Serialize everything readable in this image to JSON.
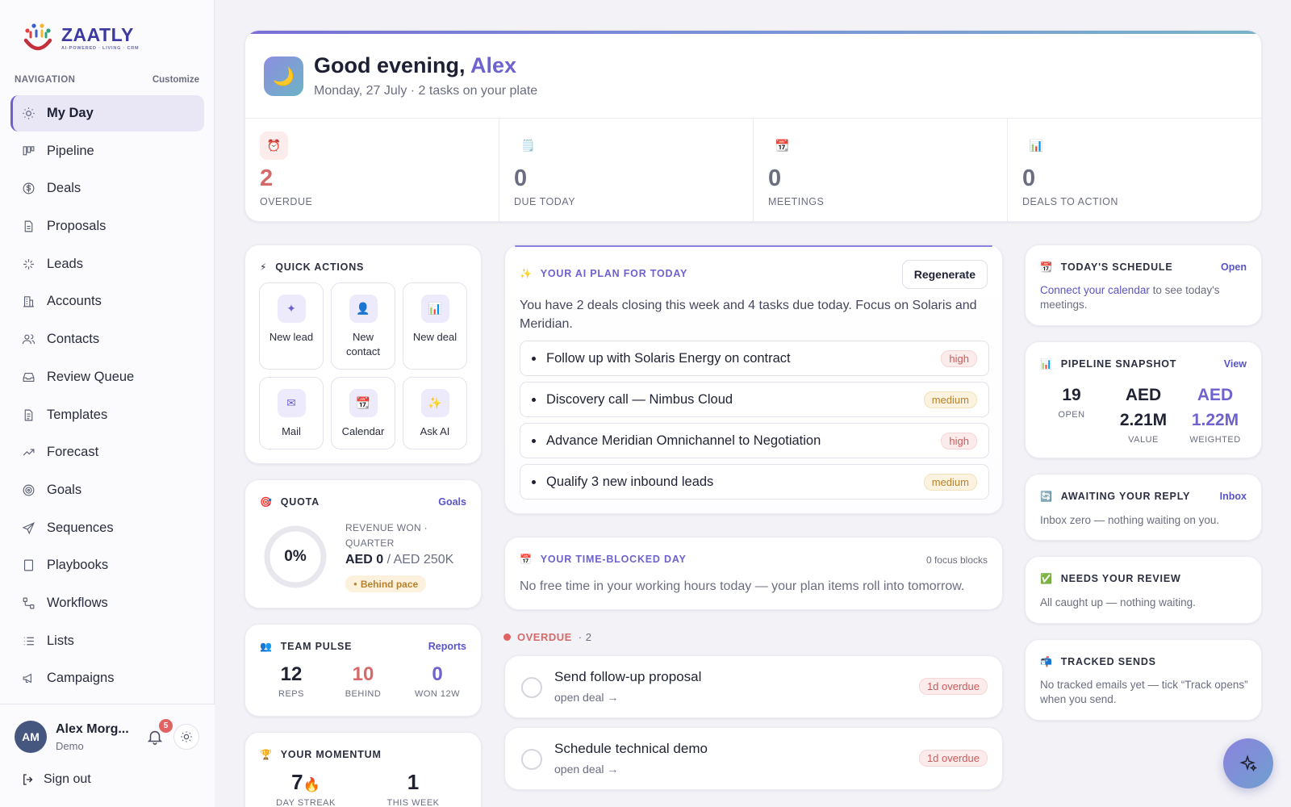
{
  "app": {
    "logo_text": "ZAATLY",
    "logo_tagline": "AI-POWERED · LIVING · CRM"
  },
  "sidebar": {
    "nav_heading": "NAVIGATION",
    "customize_label": "Customize",
    "items": [
      {
        "label": "My Day",
        "icon": "sun-icon",
        "active": true
      },
      {
        "label": "Pipeline",
        "icon": "kanban-icon"
      },
      {
        "label": "Deals",
        "icon": "dollar-icon"
      },
      {
        "label": "Proposals",
        "icon": "document-icon"
      },
      {
        "label": "Leads",
        "icon": "sparkle-icon"
      },
      {
        "label": "Accounts",
        "icon": "building-icon"
      },
      {
        "label": "Contacts",
        "icon": "users-icon"
      },
      {
        "label": "Review Queue",
        "icon": "inbox-icon"
      },
      {
        "label": "Templates",
        "icon": "file-text-icon"
      },
      {
        "label": "Forecast",
        "icon": "trend-icon"
      },
      {
        "label": "Goals",
        "icon": "target-icon"
      },
      {
        "label": "Sequences",
        "icon": "send-icon"
      },
      {
        "label": "Playbooks",
        "icon": "book-icon"
      },
      {
        "label": "Workflows",
        "icon": "workflow-icon"
      },
      {
        "label": "Lists",
        "icon": "list-icon"
      },
      {
        "label": "Campaigns",
        "icon": "megaphone-icon"
      }
    ],
    "user": {
      "initials": "AM",
      "name": "Alex Morg...",
      "role": "Demo",
      "notifications": "5"
    },
    "sign_out": "Sign out"
  },
  "hero": {
    "greeting": "Good evening,",
    "name": "Alex",
    "subtitle": "Monday, 27 July · 2 tasks on your plate",
    "icon": "moon-icon",
    "stats": [
      {
        "value": "2",
        "label": "OVERDUE",
        "icon": "alarm-clock-icon"
      },
      {
        "value": "0",
        "label": "DUE TODAY",
        "icon": "notepad-icon"
      },
      {
        "value": "0",
        "label": "MEETINGS",
        "icon": "calendar-icon"
      },
      {
        "value": "0",
        "label": "DEALS TO ACTION",
        "icon": "bar-chart-icon"
      }
    ]
  },
  "quick_actions": {
    "title": "QUICK ACTIONS",
    "items": [
      {
        "label": "New lead",
        "icon": "sparkle-icon"
      },
      {
        "label": "New contact",
        "icon": "person-icon"
      },
      {
        "label": "New deal",
        "icon": "bar-chart-icon"
      },
      {
        "label": "Mail",
        "icon": "mail-icon"
      },
      {
        "label": "Calendar",
        "icon": "calendar-icon"
      },
      {
        "label": "Ask AI",
        "icon": "sparkles-icon"
      }
    ]
  },
  "quota": {
    "title": "QUOTA",
    "link": "Goals",
    "percent": "0%",
    "progress": 0,
    "label": "REVENUE WON · QUARTER",
    "won": "AED 0",
    "target": "/ AED 250K",
    "badge": "Behind pace"
  },
  "team_pulse": {
    "title": "TEAM PULSE",
    "link": "Reports",
    "metrics": [
      {
        "value": "12",
        "label": "REPS"
      },
      {
        "value": "10",
        "label": "BEHIND"
      },
      {
        "value": "0",
        "label": "WON 12W"
      }
    ]
  },
  "momentum": {
    "title": "YOUR MOMENTUM",
    "metrics": [
      {
        "value": "7",
        "label": "DAY STREAK"
      },
      {
        "value": "1",
        "label": "THIS WEEK"
      }
    ]
  },
  "ai_plan": {
    "title": "YOUR AI PLAN FOR TODAY",
    "regenerate": "Regenerate",
    "summary": "You have 2 deals closing this week and 4 tasks due today. Focus on Solaris and Meridian.",
    "items": [
      {
        "text": "Follow up with Solaris Energy on contract",
        "priority": "high"
      },
      {
        "text": "Discovery call — Nimbus Cloud",
        "priority": "medium"
      },
      {
        "text": "Advance Meridian Omnichannel to Negotiation",
        "priority": "high"
      },
      {
        "text": "Qualify 3 new inbound leads",
        "priority": "medium"
      }
    ]
  },
  "time_blocked": {
    "title": "YOUR TIME-BLOCKED DAY",
    "count": "0 focus blocks",
    "text": "No free time in your working hours today — your plan items roll into tomorrow."
  },
  "overdue": {
    "title": "OVERDUE",
    "count": "· 2",
    "tasks": [
      {
        "title": "Send follow-up proposal",
        "sub": "open deal →",
        "badge": "1d overdue"
      },
      {
        "title": "Schedule technical demo",
        "sub": "open deal →",
        "badge": "1d overdue"
      }
    ]
  },
  "schedule": {
    "title": "TODAY'S SCHEDULE",
    "link": "Open",
    "link_text": "Connect your calendar",
    "text": " to see today's meetings."
  },
  "pipeline_snapshot": {
    "title": "PIPELINE SNAPSHOT",
    "link": "View",
    "metrics": [
      {
        "value": "19",
        "label": "OPEN"
      },
      {
        "value": "AED 2.21M",
        "label": "VALUE"
      },
      {
        "value": "AED 1.22M",
        "label": "WEIGHTED"
      }
    ]
  },
  "awaiting": {
    "title": "AWAITING YOUR REPLY",
    "link": "Inbox",
    "text": "Inbox zero — nothing waiting on you."
  },
  "review": {
    "title": "NEEDS YOUR REVIEW",
    "text": "All caught up — nothing waiting."
  },
  "tracked": {
    "title": "TRACKED SENDS",
    "text": "No tracked emails yet — tick “Track opens” when you send."
  },
  "colors": {
    "accent": "#6d62cf",
    "danger": "#d46a6a",
    "warning": "#b9812b"
  }
}
